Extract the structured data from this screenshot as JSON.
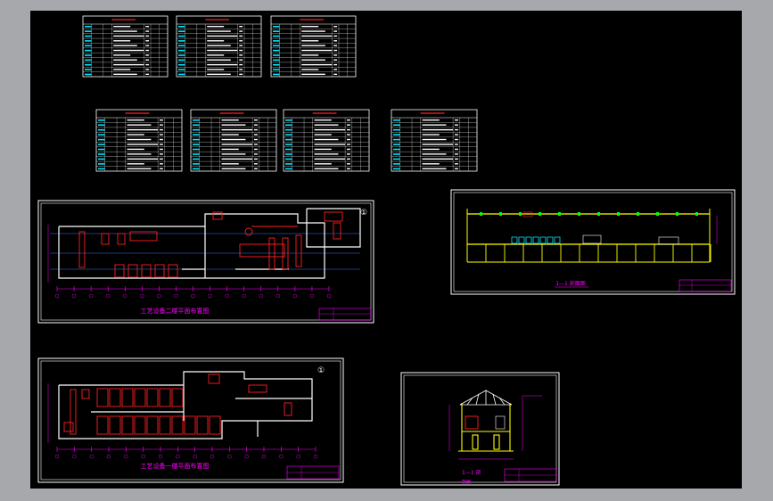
{
  "drawing": {
    "plan_second_floor_title": "工艺设备二楼平面布置图",
    "plan_first_floor_title": "工艺设备一楼平面布置图",
    "section_1_1_title": "1—1 剖面图",
    "section_small_title": "1—1 剖",
    "section_small_subtitle": "剖面",
    "sheet_marker_1": "①",
    "sheet_marker_2": "①"
  },
  "colors": {
    "background": "#000000",
    "frame": "#ffffff",
    "wall": "#ffffff",
    "equipment": "#ff2020",
    "dimension": "#ff00ff",
    "grid": "#3a7bff",
    "cyan": "#00e5ff",
    "yellow": "#ffff00",
    "green": "#00ff00"
  }
}
